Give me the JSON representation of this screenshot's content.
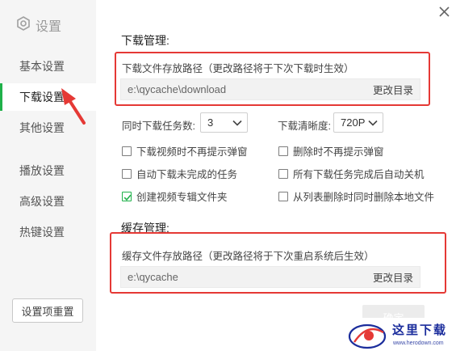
{
  "sidebar": {
    "title": "设置",
    "items": [
      {
        "label": "基本设置",
        "active": false
      },
      {
        "label": "下载设置",
        "active": true
      },
      {
        "label": "其他设置",
        "active": false
      },
      {
        "label": "播放设置",
        "active": false
      },
      {
        "label": "高级设置",
        "active": false
      },
      {
        "label": "热键设置",
        "active": false
      }
    ],
    "reset_label": "设置项重置"
  },
  "download": {
    "title": "下载管理:",
    "path_label": "下载文件存放路径（更改路径将于下次下载时生效）",
    "path_value": "e:\\qycache\\download",
    "change_label": "更改目录",
    "concurrent_label": "同时下载任务数:",
    "concurrent_value": "3",
    "quality_label": "下载清晰度:",
    "quality_value": "720P",
    "options": [
      {
        "label": "下载视频时不再提示弹窗",
        "checked": false
      },
      {
        "label": "删除时不再提示弹窗",
        "checked": false
      },
      {
        "label": "自动下载未完成的任务",
        "checked": false
      },
      {
        "label": "所有下载任务完成后自动关机",
        "checked": false
      },
      {
        "label": "创建视频专辑文件夹",
        "checked": true
      },
      {
        "label": "从列表删除时同时删除本地文件",
        "checked": false
      }
    ]
  },
  "cache": {
    "title": "缓存管理:",
    "path_label": "缓存文件存放路径（更改路径将于下次重启系统后生效）",
    "path_value": "e:\\qycache",
    "change_label": "更改目录"
  },
  "footer": {
    "ok_label": "确定"
  },
  "watermark": {
    "text": "这里下载",
    "url": "www.herodown.com"
  },
  "colors": {
    "accent": "#1fb14a",
    "highlight": "#e53935",
    "watermark": "#1b2d9c"
  },
  "icons": [
    "gear-icon",
    "close-icon",
    "chevron-down-icon",
    "check-icon",
    "arrow-annotation",
    "watermark-logo"
  ]
}
